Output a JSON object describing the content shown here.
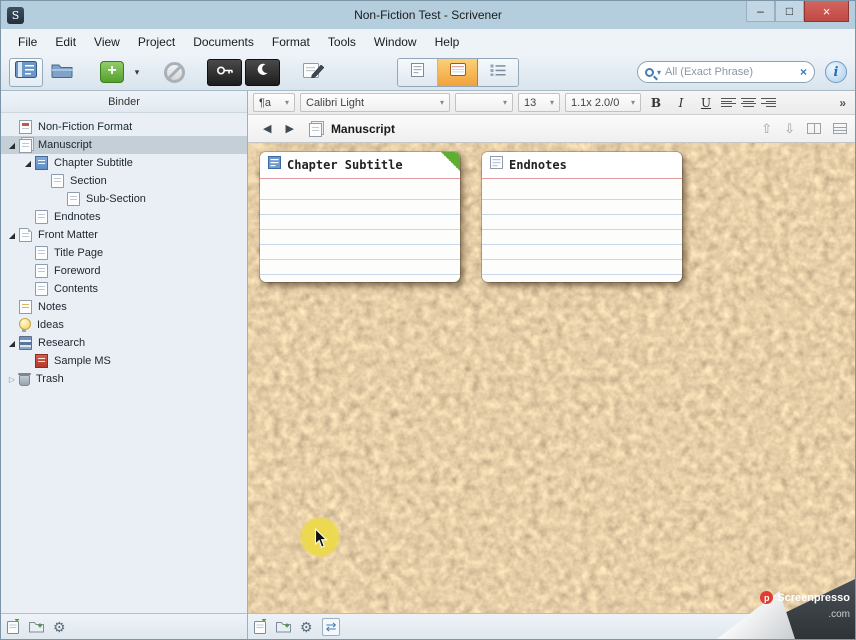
{
  "window": {
    "title": "Non-Fiction Test - Scrivener",
    "controls": {
      "minimize": "–",
      "maximize": "□",
      "close": "×"
    }
  },
  "menu": {
    "items": [
      "File",
      "Edit",
      "View",
      "Project",
      "Documents",
      "Format",
      "Tools",
      "Window",
      "Help"
    ]
  },
  "toolbar": {
    "search": {
      "placeholder": "All (Exact Phrase)",
      "clear": "×"
    }
  },
  "binder": {
    "header": "Binder",
    "items": [
      {
        "label": "Non-Fiction Format",
        "icon": "format-doc-icon",
        "level": 0
      },
      {
        "label": "Manuscript",
        "icon": "manuscript-icon",
        "level": 0,
        "selected": true,
        "expanded": true
      },
      {
        "label": "Chapter Subtitle",
        "icon": "blue-doc-icon",
        "level": 1,
        "expanded": true
      },
      {
        "label": "Section",
        "icon": "doc-icon",
        "level": 2
      },
      {
        "label": "Sub-Section",
        "icon": "doc-icon",
        "level": 3
      },
      {
        "label": "Endnotes",
        "icon": "doc-icon",
        "level": 1
      },
      {
        "label": "Front Matter",
        "icon": "folded-doc-icon",
        "level": 0,
        "expanded": true
      },
      {
        "label": "Title Page",
        "icon": "doc-icon",
        "level": 1
      },
      {
        "label": "Foreword",
        "icon": "doc-icon",
        "level": 1
      },
      {
        "label": "Contents",
        "icon": "doc-icon",
        "level": 1
      },
      {
        "label": "Notes",
        "icon": "notes-icon",
        "level": 0
      },
      {
        "label": "Ideas",
        "icon": "idea-icon",
        "level": 0
      },
      {
        "label": "Research",
        "icon": "research-icon",
        "level": 0,
        "expanded": true
      },
      {
        "label": "Sample MS",
        "icon": "red-book-icon",
        "level": 1
      },
      {
        "label": "Trash",
        "icon": "trash-icon",
        "level": 0,
        "collapsed": true
      }
    ]
  },
  "format_bar": {
    "style": "¶a",
    "font": "Calibri Light",
    "variant": "",
    "size": "13",
    "spacing": "1.1x 2.0/0",
    "bold": "B",
    "italic": "I",
    "underline": "U",
    "overflow": "»"
  },
  "nav_bar": {
    "title": "Manuscript"
  },
  "corkboard": {
    "cards": [
      {
        "title": "Chapter Subtitle",
        "icon": "blue-doc-icon",
        "label_flag": "green"
      },
      {
        "title": "Endnotes",
        "icon": "doc-icon",
        "label_flag": null
      }
    ]
  },
  "watermark": {
    "logo_letter": "p",
    "brand": "Screenpresso",
    "suffix": ".com"
  },
  "colors": {
    "titlebar": "#b5cede",
    "close_button": "#c04a45",
    "corkboard_base": "#b19070",
    "active_view_button": "#f0a23a",
    "selection": "#c4cfd8",
    "card_rule": "#c7d7e8",
    "card_top_rule": "#e39c9c",
    "label_green": "#5fae33"
  }
}
